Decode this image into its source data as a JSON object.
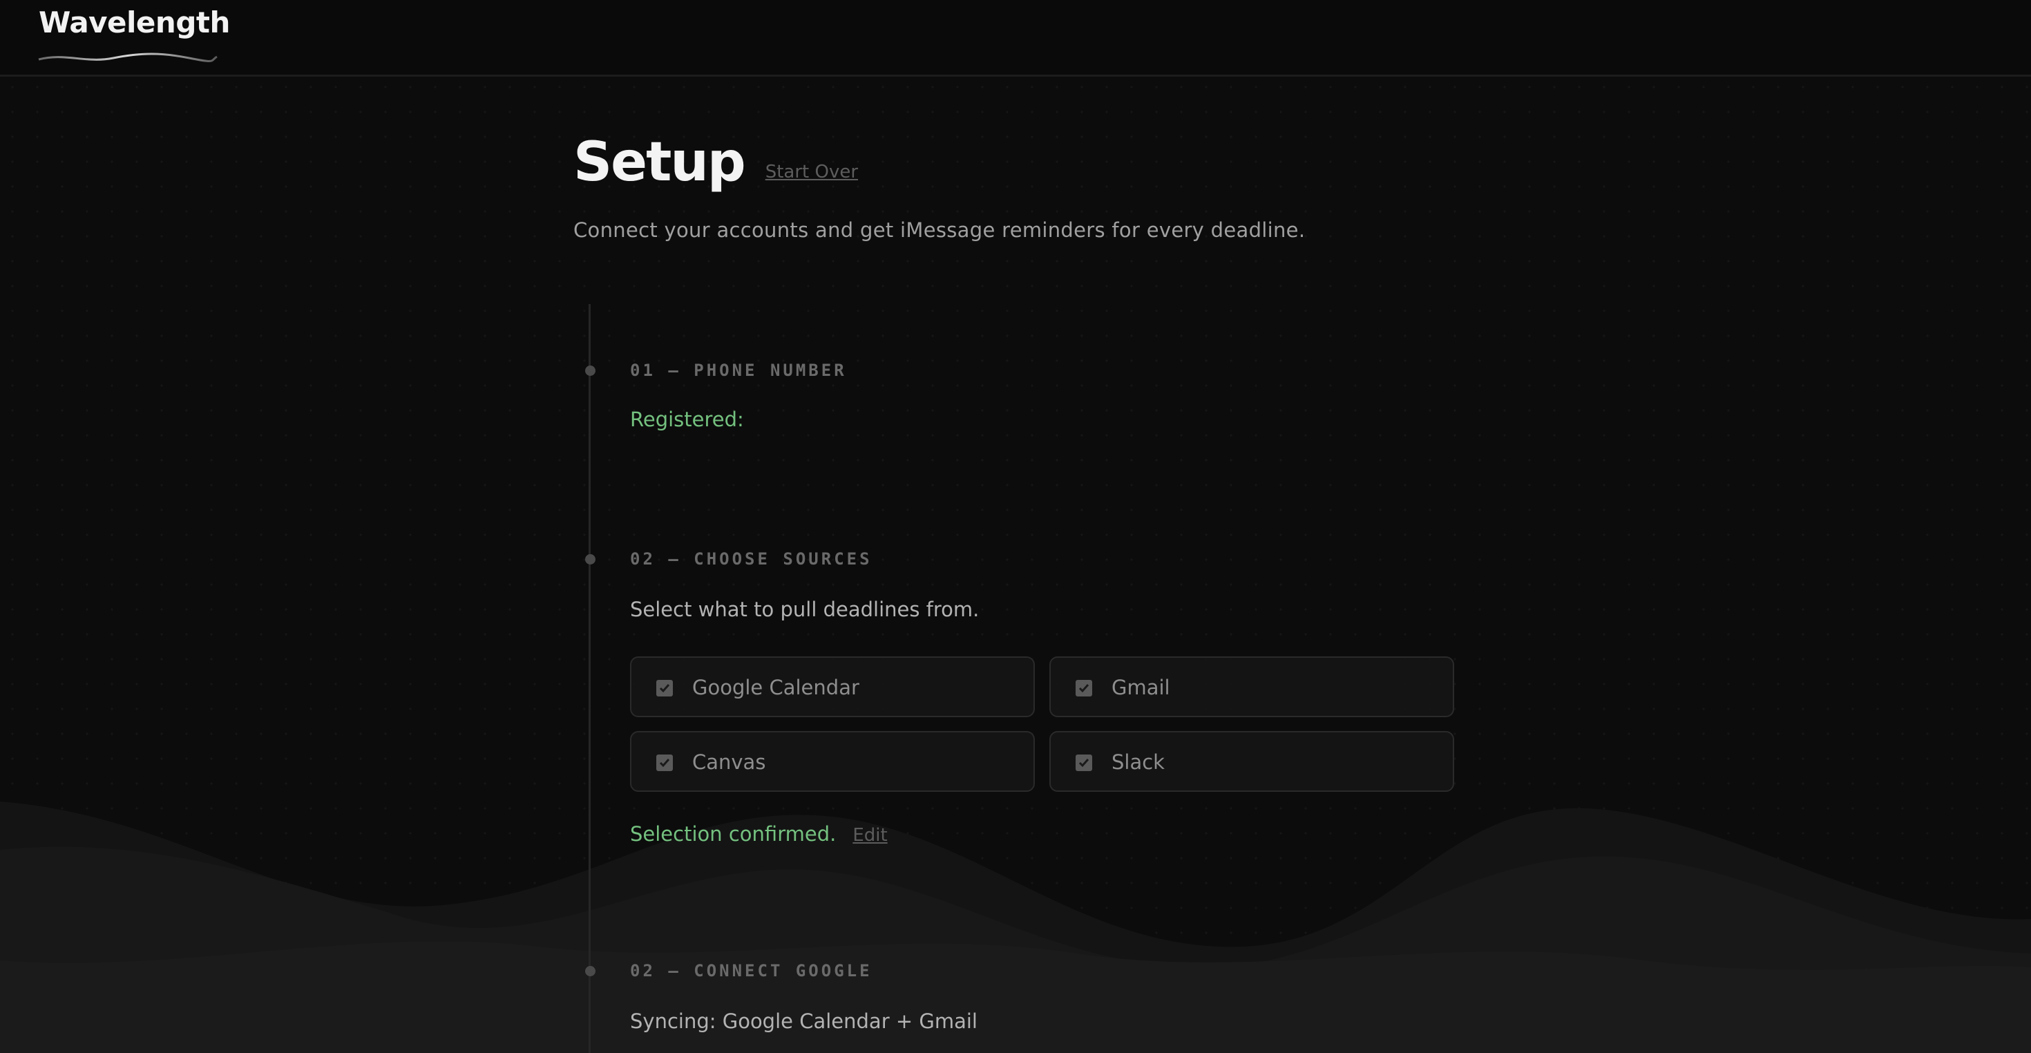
{
  "header": {
    "logo": "Wavelength"
  },
  "page": {
    "title": "Setup",
    "start_over": "Start Over",
    "subtitle": "Connect your accounts and get iMessage reminders for every deadline."
  },
  "steps": {
    "phone": {
      "label": "01 — PHONE NUMBER",
      "status": "Registered:"
    },
    "sources": {
      "label": "02 — CHOOSE SOURCES",
      "description": "Select what to pull deadlines from.",
      "options": [
        {
          "label": "Google Calendar",
          "checked": true
        },
        {
          "label": "Gmail",
          "checked": true
        },
        {
          "label": "Canvas",
          "checked": true
        },
        {
          "label": "Slack",
          "checked": true
        }
      ],
      "confirmation": "Selection confirmed.",
      "edit": "Edit"
    },
    "google": {
      "label": "02 — CONNECT GOOGLE",
      "status": "Syncing: Google Calendar + Gmail"
    }
  },
  "colors": {
    "background": "#0c0c0c",
    "success": "#74c17f",
    "muted": "#6a6a6a"
  }
}
